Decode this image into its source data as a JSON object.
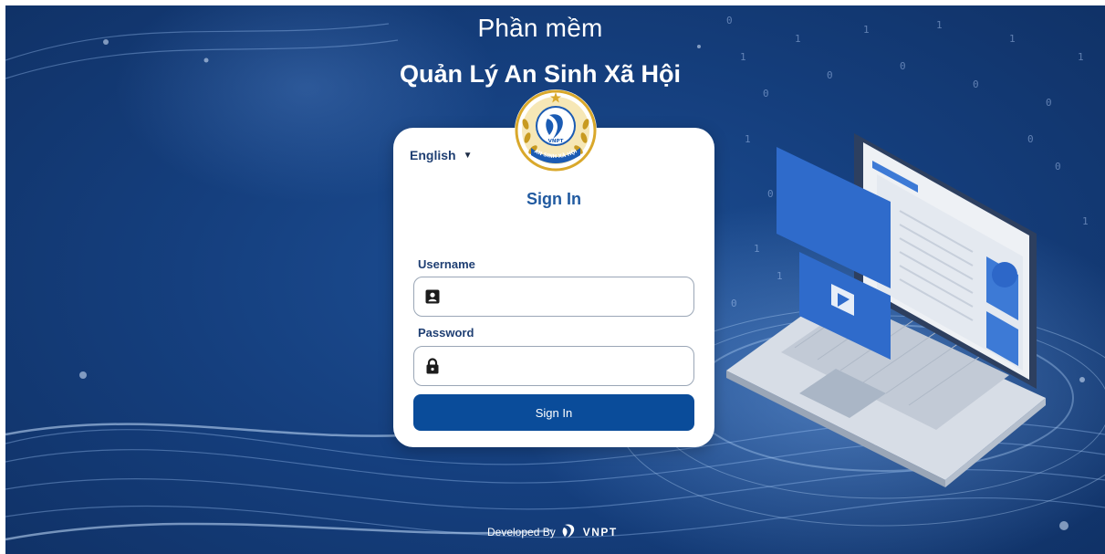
{
  "header": {
    "title_line1": "Phần mềm",
    "title_line2": "Quản Lý An Sinh Xã Hội"
  },
  "logo": {
    "icon": "vnpt-emblem-icon",
    "badge_text": "VNPT",
    "ribbon_text": "AN SINH XÃ HỘI"
  },
  "login": {
    "language": "English",
    "heading": "Sign In",
    "username_label": "Username",
    "username_value": "",
    "password_label": "Password",
    "password_value": "",
    "submit_label": "Sign In",
    "icons": [
      "user-card-icon",
      "lock-icon",
      "caret-down-icon"
    ]
  },
  "footer": {
    "developed_by": "Developed By",
    "brand": "VNPT"
  },
  "colors": {
    "background": "#153f7e",
    "card": "#ffffff",
    "accent": "#0a4c9a",
    "heading": "#215aa0"
  }
}
